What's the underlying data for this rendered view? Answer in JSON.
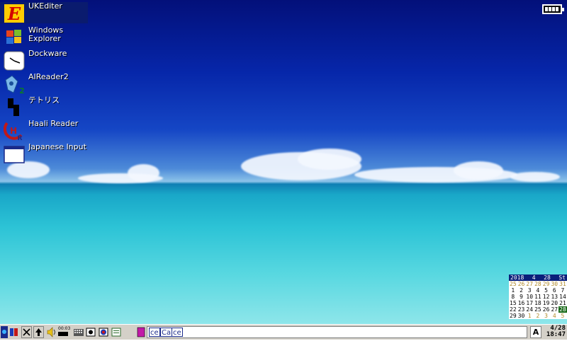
{
  "desktop_icons": [
    {
      "label": "UKEditer",
      "icon": "ukediter-icon"
    },
    {
      "label": "Windows\nExplorer",
      "icon": "windows-explorer-icon"
    },
    {
      "label": "Dockware",
      "icon": "clock-icon"
    },
    {
      "label": "AIReader2",
      "icon": "aireader-icon"
    },
    {
      "label": "テトリス",
      "icon": "tetris-icon"
    },
    {
      "label": "Haali Reader",
      "icon": "haali-reader-icon"
    },
    {
      "label": "Japanese Input",
      "icon": "window-icon"
    }
  ],
  "battery": {
    "level": 1.0
  },
  "calendar": {
    "year": "2018",
    "month": "4",
    "day": "28",
    "weekday": "St",
    "weeks": [
      [
        "25",
        "26",
        "27",
        "28",
        "29",
        "30",
        "31"
      ],
      [
        "1",
        "2",
        "3",
        "4",
        "5",
        "6",
        "7"
      ],
      [
        "8",
        "9",
        "10",
        "11",
        "12",
        "13",
        "14"
      ],
      [
        "15",
        "16",
        "17",
        "18",
        "19",
        "20",
        "21"
      ],
      [
        "22",
        "23",
        "24",
        "25",
        "26",
        "27",
        "28"
      ],
      [
        "29",
        "30",
        "1",
        "2",
        "3",
        "4",
        "5"
      ]
    ],
    "today": "28"
  },
  "taskbar": {
    "tasks": [
      "ce",
      "Ca",
      "ce"
    ],
    "input_mode": "A",
    "date": "4/28",
    "time": "18:47",
    "volume_readout": "00:03"
  },
  "colors": {
    "selected_icon_bg": "#0a1b6e",
    "task_border": "#1a2a8a"
  }
}
